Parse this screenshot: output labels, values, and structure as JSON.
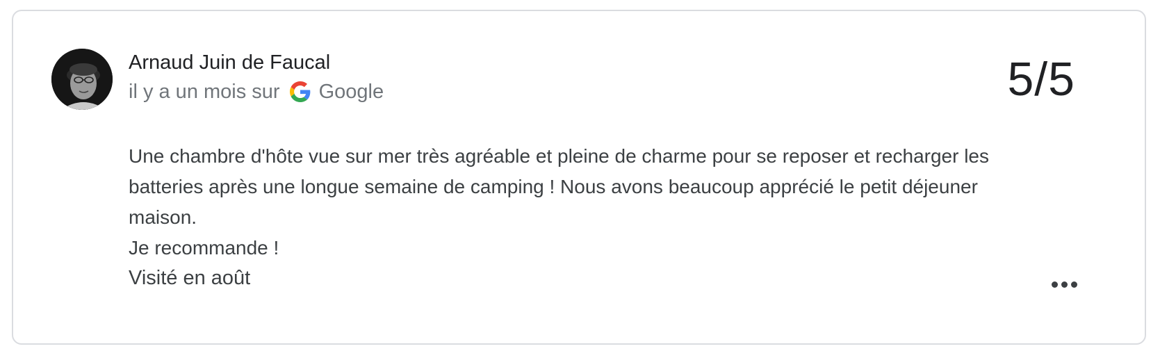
{
  "review": {
    "author_name": "Arnaud Juin de Faucal",
    "time_ago": "il y a un mois sur",
    "source": "Google",
    "score": "5/5",
    "text_lines": [
      "Une chambre d'hôte vue sur mer très agréable et pleine de charme pour se reposer et recharger les batteries après une longue semaine de camping ! Nous avons beaucoup apprécié le petit déjeuner maison.",
      "Je recommande !"
    ],
    "visit": "Visité en août",
    "icons": {
      "avatar": "avatar-photo",
      "source": "google-logo-icon",
      "more": "more-horizontal-icon"
    }
  },
  "colors": {
    "border": "#dadce0",
    "text_primary": "#202124",
    "text_secondary": "#70757a",
    "text_body": "#3c4043",
    "google_blue": "#4285F4",
    "google_red": "#EA4335",
    "google_yellow": "#FBBC05",
    "google_green": "#34A853"
  }
}
